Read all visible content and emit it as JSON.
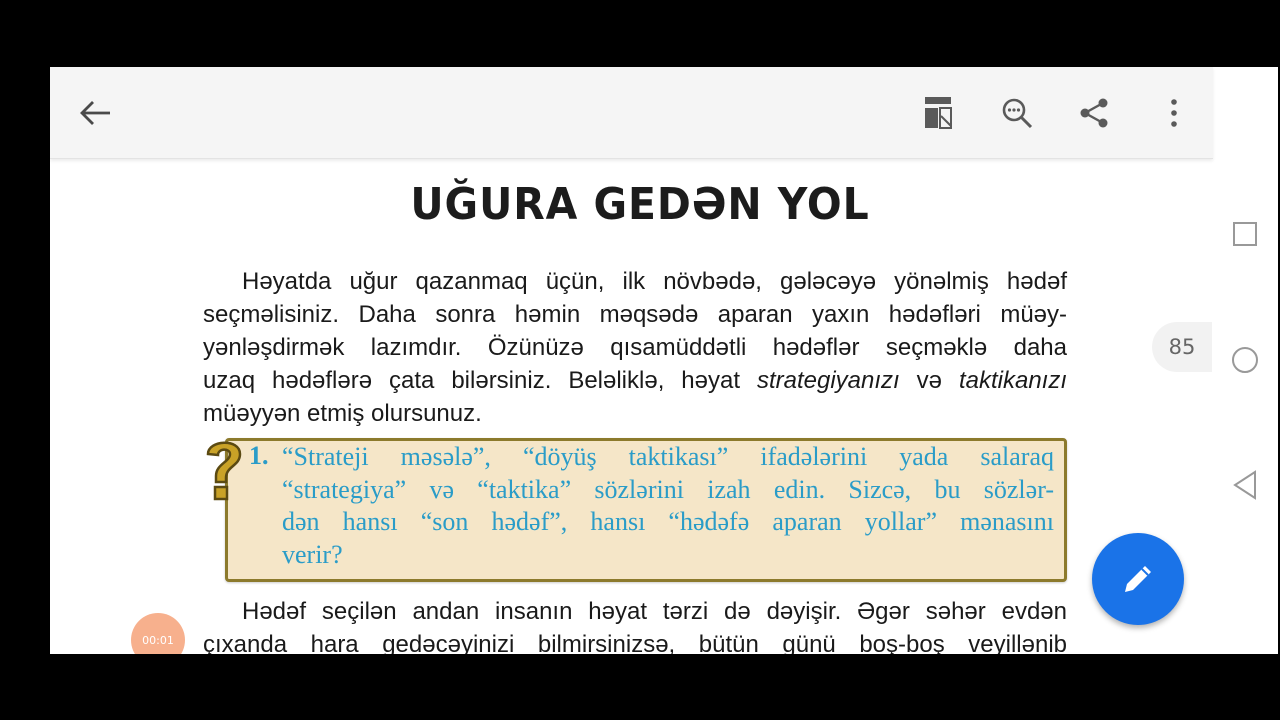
{
  "toolbar": {
    "back_icon": "arrow-left-icon",
    "icons": [
      "reading-mode-icon",
      "search-zoom-icon",
      "share-icon",
      "more-vert-icon"
    ]
  },
  "document": {
    "title": "UĞURA GEDƏN YOL",
    "paragraph1": [
      "Həyatda uğur qazanmaq üçün, ilk növbədə, gələcəyə yönəlmiş hədəf",
      "seçməlisiniz. Daha sonra həmin məqsədə aparan yaxın hədəfləri müəy-",
      "yənləşdirmək lazımdır. Özünüzə qısamüddətli hədəflər seçməklə daha"
    ],
    "paragraph1_line4_a": "uzaq hədəflərə çata bilərsiniz. Beləliklə, həyat ",
    "paragraph1_line4_em1": "strategiyanızı",
    "paragraph1_line4_b": " və ",
    "paragraph1_line4_em2": "taktikanızı",
    "paragraph1_line5": "müəyyən etmiş olursunuz.",
    "question_number": "1.",
    "question_lines": [
      "“Strateji məsələ”, “döyüş taktikası” ifadələrini yada salaraq",
      "“strategiya” və “taktika” sözlərini izah edin. Sizcə, bu sözlər-",
      "dən hansı “son hədəf”, hansı “hədəfə aparan yollar” mənasını",
      "verir?"
    ],
    "paragraph2": [
      "Hədəf seçilən andan insanın həyat tərzi də dəyişir. Əgər səhər evdən",
      "çıxanda hara gedəcəyinizi bilmirsinizsə, bütün günü boş-boş veyillənib"
    ]
  },
  "page_number": "85",
  "recording_time": "00:01",
  "colors": {
    "accent": "#1a73e8",
    "question_text": "#2a9cc8",
    "question_bg": "#f5e6c8",
    "question_border": "#8c7a2c"
  }
}
